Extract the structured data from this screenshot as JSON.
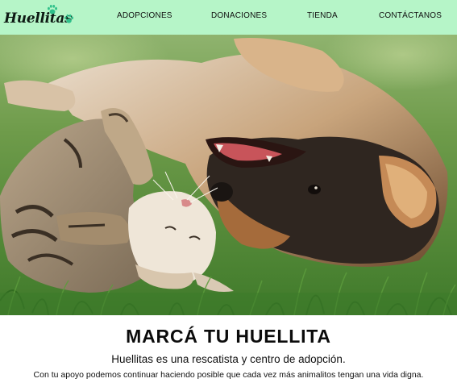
{
  "brand": {
    "name": "Huellitas",
    "icon": "paw-print-icon",
    "accent": "#2fc08a"
  },
  "nav": {
    "background": "#b6f5c8",
    "items": [
      {
        "label": "ADOPCIONES"
      },
      {
        "label": "DONACIONES"
      },
      {
        "label": "TIENDA"
      },
      {
        "label": "CONTÁCTANOS"
      }
    ]
  },
  "hero": {
    "subject": "hero-photo-cat-and-dog-on-grass"
  },
  "content": {
    "headline": "MARCÁ TU HUELLITA",
    "intro": "Huellitas es una rescatista y centro de adopción.",
    "body": "Con tu apoyo podemos continuar haciendo posible que cada vez más animalitos tengan una vida digna."
  }
}
